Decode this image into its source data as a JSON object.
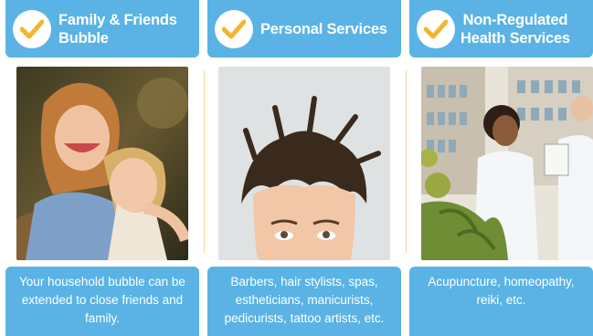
{
  "cards": [
    {
      "title_line1": "Family & Friends",
      "title_line2": "Bubble",
      "photo": "two-children-hugging",
      "description": "Your household bubble can be extended to close friends and family."
    },
    {
      "title_line1": "Personal Services",
      "title_line2": "",
      "photo": "man-with-messy-hair",
      "description": "Barbers, hair stylists, spas, estheticians, manicurists, pedicurists, tattoo artists, etc."
    },
    {
      "title_line1": "Non-Regulated",
      "title_line2": "Health Services",
      "photo": "pharmacy-workers",
      "description": "Acupuncture, homeopathy, reiki, etc."
    }
  ],
  "colors": {
    "accent": "#5ab3e4",
    "check": "#f2b52e"
  },
  "icons": {
    "badge": "checkmark-icon"
  }
}
